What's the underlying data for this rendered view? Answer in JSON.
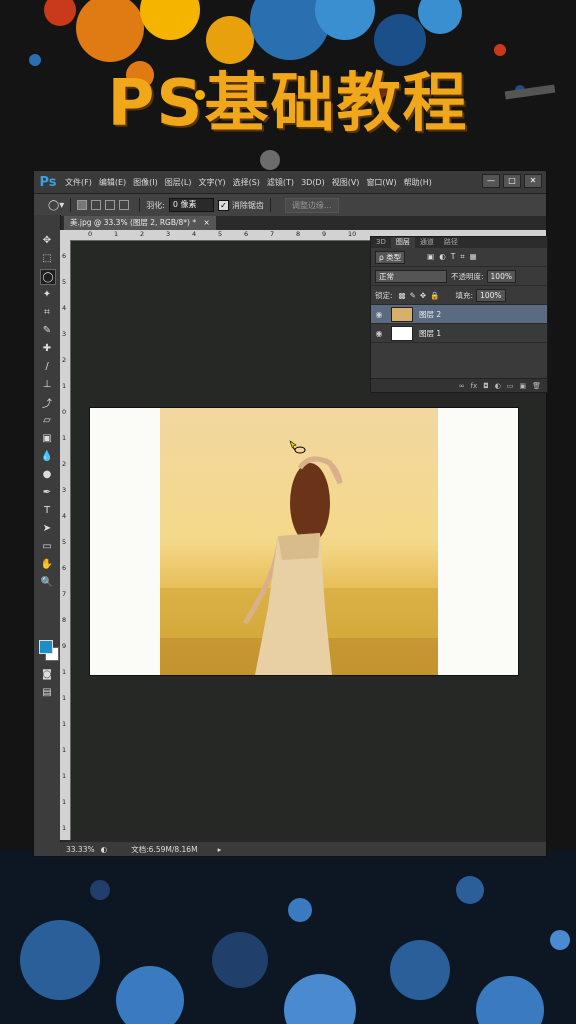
{
  "banner": {
    "title": "PS基础教程"
  },
  "app": {
    "logo": "Ps"
  },
  "menu": [
    "文件(F)",
    "编辑(E)",
    "图像(I)",
    "图层(L)",
    "文字(Y)",
    "选择(S)",
    "滤镜(T)",
    "3D(D)",
    "视图(V)",
    "窗口(W)",
    "帮助(H)"
  ],
  "window_controls": [
    "—",
    "□",
    "✕"
  ],
  "options": {
    "feather_label": "羽化:",
    "feather_value": "0 像素",
    "antialias_label": "消除锯齿",
    "refine_label": "调整边缘..."
  },
  "document_tab": {
    "label": "美.jpg @ 33.3% (图层 2, RGB/8*) *"
  },
  "ruler_top": [
    "0",
    "1",
    "2",
    "3",
    "4",
    "5",
    "6",
    "7",
    "8",
    "9",
    "10"
  ],
  "ruler_left": [
    "6",
    "5",
    "4",
    "3",
    "2",
    "1",
    "0",
    "1",
    "2",
    "3",
    "4",
    "5",
    "6",
    "7",
    "8",
    "9",
    "1",
    "1",
    "1",
    "1",
    "1",
    "1",
    "1"
  ],
  "panel": {
    "tabs": [
      "3D",
      "图层",
      "通道",
      "路径"
    ],
    "filter_label": "ρ 类型",
    "blend_mode": "正常",
    "opacity_label": "不透明度:",
    "opacity_value": "100%",
    "lock_label": "锁定:",
    "fill_label": "填充:",
    "fill_value": "100%",
    "layers": [
      {
        "name": "图层 2"
      },
      {
        "name": "图层 1"
      }
    ],
    "footer_icons": [
      "∞",
      "fx",
      "◘",
      "◐",
      "▭",
      "▣",
      "🗑"
    ]
  },
  "status": {
    "zoom": "33.33%",
    "doc": "文档:6.59M/8.16M"
  },
  "colors": {
    "foreground": "#1c8fc6",
    "background": "#ffffff",
    "accent_orange": "#f0a71a"
  },
  "icons": [
    "lasso-icon",
    "move-icon",
    "marquee-icon",
    "crop-icon",
    "eyedropper-icon",
    "brush-icon",
    "eraser-icon",
    "pen-icon",
    "type-icon",
    "hand-icon",
    "zoom-icon",
    "eye-icon"
  ]
}
